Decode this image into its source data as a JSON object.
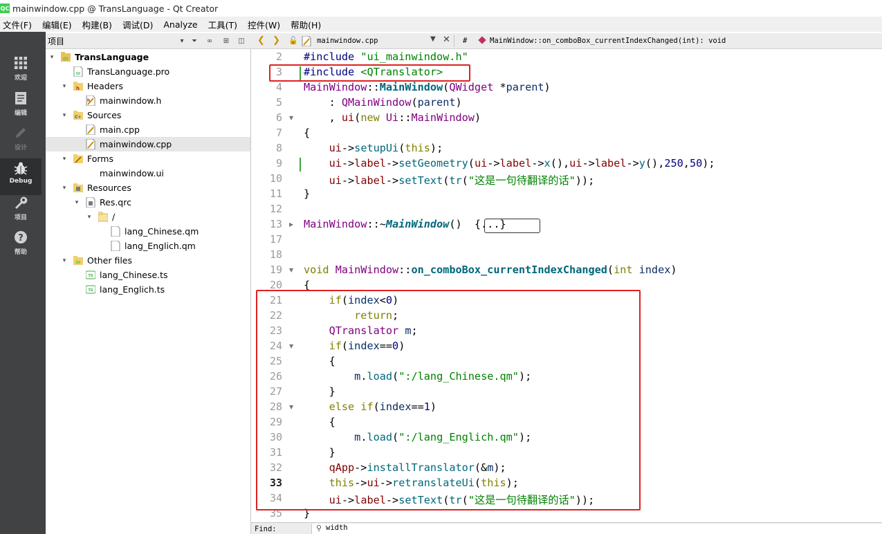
{
  "window": {
    "title": "mainwindow.cpp @ TransLanguage - Qt Creator",
    "app_icon": "QC"
  },
  "menubar": {
    "items": [
      "文件(F)",
      "编辑(E)",
      "构建(B)",
      "调试(D)",
      "Analyze",
      "工具(T)",
      "控件(W)",
      "帮助(H)"
    ]
  },
  "modes": [
    {
      "label": "欢迎",
      "icon": "grid-icon"
    },
    {
      "label": "编辑",
      "icon": "document-icon"
    },
    {
      "label": "设计",
      "icon": "pencil-icon",
      "enabled": false
    },
    {
      "label": "Debug",
      "icon": "bug-icon",
      "active": true
    },
    {
      "label": "项目",
      "icon": "wrench-icon"
    },
    {
      "label": "帮助",
      "icon": "help-icon"
    }
  ],
  "project_panel": {
    "header": "项目",
    "tree": [
      {
        "label": "TransLanguage",
        "icon": "qt-project-icon",
        "bold": true
      },
      {
        "label": "TransLanguage.pro",
        "icon": "pro-file-icon"
      },
      {
        "label": "Headers",
        "icon": "header-folder-icon"
      },
      {
        "label": "mainwindow.h",
        "icon": "h-file-icon"
      },
      {
        "label": "Sources",
        "icon": "source-folder-icon"
      },
      {
        "label": "main.cpp",
        "icon": "cpp-file-icon"
      },
      {
        "label": "mainwindow.cpp",
        "icon": "cpp-file-icon",
        "selected": true
      },
      {
        "label": "Forms",
        "icon": "forms-folder-icon"
      },
      {
        "label": "mainwindow.ui",
        "icon": "ui-file-icon"
      },
      {
        "label": "Resources",
        "icon": "resources-folder-icon"
      },
      {
        "label": "Res.qrc",
        "icon": "qrc-file-icon"
      },
      {
        "label": "/",
        "icon": "folder-icon"
      },
      {
        "label": "lang_Chinese.qm",
        "icon": "blank-file-icon"
      },
      {
        "label": "lang_Englich.qm",
        "icon": "blank-file-icon"
      },
      {
        "label": "Other files",
        "icon": "other-folder-icon"
      },
      {
        "label": "lang_Chinese.ts",
        "icon": "ts-file-icon"
      },
      {
        "label": "lang_Englich.ts",
        "icon": "ts-file-icon"
      }
    ]
  },
  "editor": {
    "file_combo": "mainwindow.cpp",
    "hash": "#",
    "symbol": "MainWindow::on_comboBox_currentIndexChanged(int): void",
    "current_line": "33",
    "lines": [
      {
        "n": "2",
        "t": [
          [
            "#include ",
            "pp"
          ],
          [
            "\"ui_mainwindow.h\"",
            "str"
          ]
        ]
      },
      {
        "n": "3",
        "t": [
          [
            "#include ",
            "pp"
          ],
          [
            "<QTranslator>",
            "str"
          ]
        ]
      },
      {
        "n": "4",
        "t": [
          [
            "MainWindow",
            "type"
          ],
          [
            "::",
            "op"
          ],
          [
            "MainWindow",
            "fnb"
          ],
          [
            "(",
            "op"
          ],
          [
            "QWidget",
            "type"
          ],
          [
            " *",
            "op"
          ],
          [
            "parent",
            "var"
          ],
          [
            ")",
            "op"
          ]
        ]
      },
      {
        "n": "5",
        "t": [
          [
            "    : ",
            "op"
          ],
          [
            "QMainWindow",
            "type"
          ],
          [
            "(",
            "op"
          ],
          [
            "parent",
            "var"
          ],
          [
            ")",
            "op"
          ]
        ]
      },
      {
        "n": "6",
        "fold": true,
        "t": [
          [
            "    , ",
            "op"
          ],
          [
            "ui",
            "mem"
          ],
          [
            "(",
            "op"
          ],
          [
            "new ",
            "kw"
          ],
          [
            "Ui",
            "type"
          ],
          [
            "::",
            "op"
          ],
          [
            "MainWindow",
            "type"
          ],
          [
            ")",
            "op"
          ]
        ]
      },
      {
        "n": "7",
        "t": [
          [
            "{",
            "op"
          ]
        ]
      },
      {
        "n": "8",
        "t": [
          [
            "    ",
            "op"
          ],
          [
            "ui",
            "mem"
          ],
          [
            "->",
            "op"
          ],
          [
            "setupUi",
            "fn"
          ],
          [
            "(",
            "op"
          ],
          [
            "this",
            "kw"
          ],
          [
            ");",
            "op"
          ]
        ]
      },
      {
        "n": "9",
        "t": [
          [
            "    ",
            "op"
          ],
          [
            "ui",
            "mem"
          ],
          [
            "->",
            "op"
          ],
          [
            "label",
            "mem"
          ],
          [
            "->",
            "op"
          ],
          [
            "setGeometry",
            "fn"
          ],
          [
            "(",
            "op"
          ],
          [
            "ui",
            "mem"
          ],
          [
            "->",
            "op"
          ],
          [
            "label",
            "mem"
          ],
          [
            "->",
            "op"
          ],
          [
            "x",
            "fn"
          ],
          [
            "(),",
            "op"
          ],
          [
            "ui",
            "mem"
          ],
          [
            "->",
            "op"
          ],
          [
            "label",
            "mem"
          ],
          [
            "->",
            "op"
          ],
          [
            "y",
            "fn"
          ],
          [
            "(),",
            "op"
          ],
          [
            "250",
            "num"
          ],
          [
            ",",
            "op"
          ],
          [
            "50",
            "num"
          ],
          [
            ");",
            "op"
          ]
        ]
      },
      {
        "n": "10",
        "t": [
          [
            "    ",
            "op"
          ],
          [
            "ui",
            "mem"
          ],
          [
            "->",
            "op"
          ],
          [
            "label",
            "mem"
          ],
          [
            "->",
            "op"
          ],
          [
            "setText",
            "fn"
          ],
          [
            "(",
            "op"
          ],
          [
            "tr",
            "fn"
          ],
          [
            "(",
            "op"
          ],
          [
            "\"这是一句待翻译的话\"",
            "str"
          ],
          [
            "));",
            "op"
          ]
        ]
      },
      {
        "n": "11",
        "t": [
          [
            "}",
            "op"
          ]
        ]
      },
      {
        "n": "12",
        "t": []
      },
      {
        "n": "13",
        "fold_right": true,
        "t": [
          [
            "MainWindow",
            "type"
          ],
          [
            "::~",
            "op"
          ],
          [
            "MainWindow",
            "fnbi"
          ],
          [
            "()  ",
            "op"
          ],
          [
            "{...}",
            "op"
          ]
        ]
      },
      {
        "n": "17",
        "t": []
      },
      {
        "n": "18",
        "t": []
      },
      {
        "n": "19",
        "fold": true,
        "t": [
          [
            "void ",
            "kw"
          ],
          [
            "MainWindow",
            "type"
          ],
          [
            "::",
            "op"
          ],
          [
            "on_comboBox_currentIndexChanged",
            "fnb"
          ],
          [
            "(",
            "op"
          ],
          [
            "int ",
            "kw"
          ],
          [
            "index",
            "var"
          ],
          [
            ")",
            "op"
          ]
        ]
      },
      {
        "n": "20",
        "t": [
          [
            "{",
            "op"
          ]
        ]
      },
      {
        "n": "21",
        "t": [
          [
            "    ",
            "op"
          ],
          [
            "if",
            "kw"
          ],
          [
            "(",
            "op"
          ],
          [
            "index",
            "var"
          ],
          [
            "<",
            "op"
          ],
          [
            "0",
            "num"
          ],
          [
            ")",
            "op"
          ]
        ]
      },
      {
        "n": "22",
        "t": [
          [
            "        ",
            "op"
          ],
          [
            "return",
            "kw"
          ],
          [
            ";",
            "op"
          ]
        ]
      },
      {
        "n": "23",
        "t": [
          [
            "    ",
            "op"
          ],
          [
            "QTranslator ",
            "type"
          ],
          [
            "m",
            "var"
          ],
          [
            ";",
            "op"
          ]
        ]
      },
      {
        "n": "24",
        "fold": true,
        "t": [
          [
            "    ",
            "op"
          ],
          [
            "if",
            "kw"
          ],
          [
            "(",
            "op"
          ],
          [
            "index",
            "var"
          ],
          [
            "==",
            "op"
          ],
          [
            "0",
            "num"
          ],
          [
            ")",
            "op"
          ]
        ]
      },
      {
        "n": "25",
        "t": [
          [
            "    {",
            "op"
          ]
        ]
      },
      {
        "n": "26",
        "t": [
          [
            "        ",
            "op"
          ],
          [
            "m",
            "var"
          ],
          [
            ".",
            "op"
          ],
          [
            "load",
            "fn"
          ],
          [
            "(",
            "op"
          ],
          [
            "\":/lang_Chinese.qm\"",
            "str"
          ],
          [
            ");",
            "op"
          ]
        ]
      },
      {
        "n": "27",
        "t": [
          [
            "    }",
            "op"
          ]
        ]
      },
      {
        "n": "28",
        "fold": true,
        "t": [
          [
            "    ",
            "op"
          ],
          [
            "else if",
            "kw"
          ],
          [
            "(",
            "op"
          ],
          [
            "index",
            "var"
          ],
          [
            "==",
            "op"
          ],
          [
            "1",
            "num"
          ],
          [
            ")",
            "op"
          ]
        ]
      },
      {
        "n": "29",
        "t": [
          [
            "    {",
            "op"
          ]
        ]
      },
      {
        "n": "30",
        "t": [
          [
            "        ",
            "op"
          ],
          [
            "m",
            "var"
          ],
          [
            ".",
            "op"
          ],
          [
            "load",
            "fn"
          ],
          [
            "(",
            "op"
          ],
          [
            "\":/lang_Englich.qm\"",
            "str"
          ],
          [
            ");",
            "op"
          ]
        ]
      },
      {
        "n": "31",
        "t": [
          [
            "    }",
            "op"
          ]
        ]
      },
      {
        "n": "32",
        "t": [
          [
            "    ",
            "op"
          ],
          [
            "qApp",
            "mem"
          ],
          [
            "->",
            "op"
          ],
          [
            "installTranslator",
            "fn"
          ],
          [
            "(&",
            "op"
          ],
          [
            "m",
            "var"
          ],
          [
            ");",
            "op"
          ]
        ]
      },
      {
        "n": "33",
        "t": [
          [
            "    ",
            "op"
          ],
          [
            "this",
            "kw"
          ],
          [
            "->",
            "op"
          ],
          [
            "ui",
            "mem"
          ],
          [
            "->",
            "op"
          ],
          [
            "retranslateUi",
            "fn"
          ],
          [
            "(",
            "op"
          ],
          [
            "this",
            "kw"
          ],
          [
            ");",
            "op"
          ]
        ]
      },
      {
        "n": "34",
        "t": [
          [
            "    ",
            "op"
          ],
          [
            "ui",
            "mem"
          ],
          [
            "->",
            "op"
          ],
          [
            "label",
            "mem"
          ],
          [
            "->",
            "op"
          ],
          [
            "setText",
            "fn"
          ],
          [
            "(",
            "op"
          ],
          [
            "tr",
            "fn"
          ],
          [
            "(",
            "op"
          ],
          [
            "\"这是一句待翻译的话\"",
            "str"
          ],
          [
            "));",
            "op"
          ]
        ]
      },
      {
        "n": "35",
        "t": [
          [
            "}",
            "op"
          ]
        ]
      }
    ]
  },
  "find_bar": {
    "label": "Find:",
    "value": "width"
  },
  "colors": {
    "highlight_box": "#e02020",
    "modebar": "#404244",
    "keyword": "#808000",
    "string": "#008000",
    "type": "#800080",
    "function": "#00677c"
  }
}
